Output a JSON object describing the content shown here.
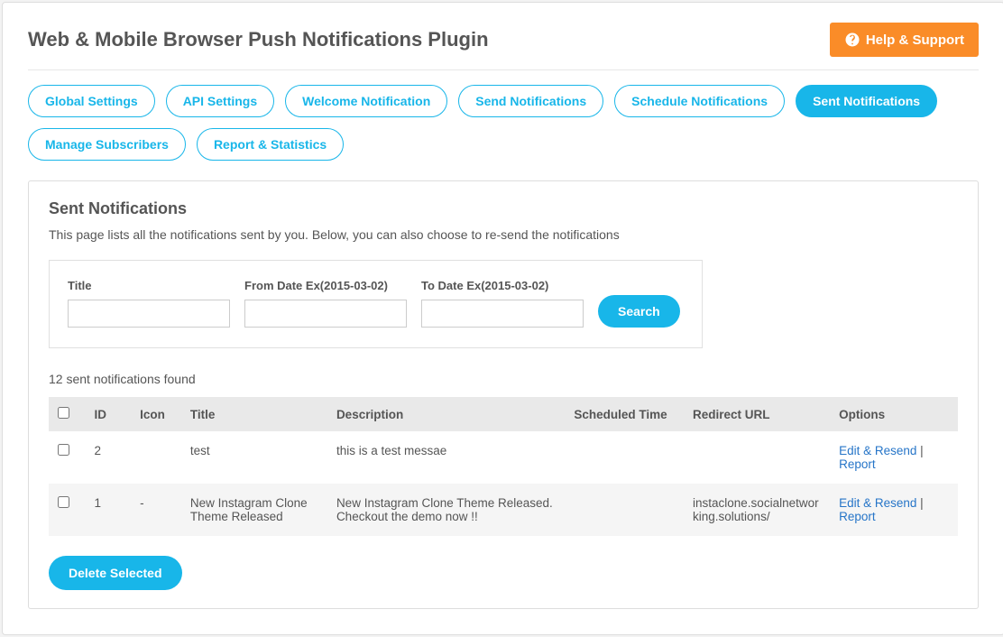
{
  "header": {
    "title": "Web & Mobile Browser Push Notifications Plugin",
    "help_button": "Help & Support"
  },
  "tabs": [
    {
      "label": "Global Settings",
      "active": false
    },
    {
      "label": "API Settings",
      "active": false
    },
    {
      "label": "Welcome Notification",
      "active": false
    },
    {
      "label": "Send Notifications",
      "active": false
    },
    {
      "label": "Schedule Notifications",
      "active": false
    },
    {
      "label": "Sent Notifications",
      "active": true
    },
    {
      "label": "Manage Subscribers",
      "active": false
    },
    {
      "label": "Report & Statistics",
      "active": false
    }
  ],
  "panel": {
    "title": "Sent Notifications",
    "description": "This page lists all the notifications sent by you. Below, you can also choose to re-send the notifications",
    "count_text": "12 sent notifications found",
    "delete_button": "Delete Selected"
  },
  "search": {
    "title_label": "Title",
    "from_label": "From Date Ex(2015-03-02)",
    "to_label": "To Date Ex(2015-03-02)",
    "button": "Search",
    "title_value": "",
    "from_value": "",
    "to_value": ""
  },
  "table": {
    "headers": {
      "id": "ID",
      "icon": "Icon",
      "title": "Title",
      "description": "Description",
      "scheduled": "Scheduled Time",
      "redirect": "Redirect URL",
      "options": "Options"
    },
    "edit_label": "Edit & Resend",
    "report_label": "Report",
    "rows": [
      {
        "id": "2",
        "icon": "",
        "title": "test",
        "description": "this is a test messae",
        "scheduled": "",
        "redirect": ""
      },
      {
        "id": "1",
        "icon": "-",
        "title": "New Instagram Clone Theme Released",
        "description": "New Instagram Clone Theme Released. Checkout the demo now !!",
        "scheduled": "",
        "redirect": "instaclone.socialnetworking.solutions/"
      }
    ]
  }
}
